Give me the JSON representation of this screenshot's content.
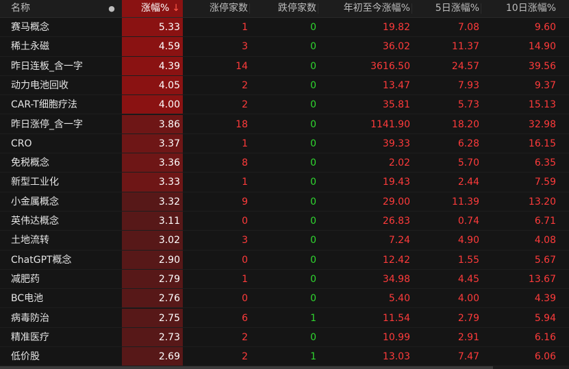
{
  "header": {
    "name": "名称",
    "dot": "●",
    "pct": "涨幅%",
    "sort_arrow": "↓",
    "up_count": "涨停家数",
    "down_count": "跌停家数",
    "ytd": "年初至今涨幅%",
    "d5": "5日涨幅%",
    "d10": "10日涨幅%"
  },
  "colors": {
    "up": "#ff3b3b",
    "down": "#2fd62f",
    "highlight_strong": "#8a1212",
    "highlight_mid": "#6e1616",
    "highlight_weak": "#571818"
  },
  "rows": [
    {
      "name": "赛马概念",
      "pct": "5.33",
      "up": "1",
      "down": "0",
      "ytd": "19.82",
      "d5": "7.08",
      "d10": "9.60"
    },
    {
      "name": "稀土永磁",
      "pct": "4.59",
      "up": "3",
      "down": "0",
      "ytd": "36.02",
      "d5": "11.37",
      "d10": "14.90"
    },
    {
      "name": "昨日连板_含一字",
      "pct": "4.39",
      "up": "14",
      "down": "0",
      "ytd": "3616.50",
      "d5": "24.57",
      "d10": "39.56"
    },
    {
      "name": "动力电池回收",
      "pct": "4.05",
      "up": "2",
      "down": "0",
      "ytd": "13.47",
      "d5": "7.93",
      "d10": "9.37"
    },
    {
      "name": "CAR-T细胞疗法",
      "pct": "4.00",
      "up": "2",
      "down": "0",
      "ytd": "35.81",
      "d5": "5.73",
      "d10": "15.13"
    },
    {
      "name": "昨日涨停_含一字",
      "pct": "3.86",
      "up": "18",
      "down": "0",
      "ytd": "1141.90",
      "d5": "18.20",
      "d10": "32.98"
    },
    {
      "name": "CRO",
      "pct": "3.37",
      "up": "1",
      "down": "0",
      "ytd": "39.33",
      "d5": "6.28",
      "d10": "16.15"
    },
    {
      "name": "免税概念",
      "pct": "3.36",
      "up": "8",
      "down": "0",
      "ytd": "2.02",
      "d5": "5.70",
      "d10": "6.35"
    },
    {
      "name": "新型工业化",
      "pct": "3.33",
      "up": "1",
      "down": "0",
      "ytd": "19.43",
      "d5": "2.44",
      "d10": "7.59"
    },
    {
      "name": "小金属概念",
      "pct": "3.32",
      "up": "9",
      "down": "0",
      "ytd": "29.00",
      "d5": "11.39",
      "d10": "13.20"
    },
    {
      "name": "英伟达概念",
      "pct": "3.11",
      "up": "0",
      "down": "0",
      "ytd": "26.83",
      "d5": "0.74",
      "d10": "6.71"
    },
    {
      "name": "土地流转",
      "pct": "3.02",
      "up": "3",
      "down": "0",
      "ytd": "7.24",
      "d5": "4.90",
      "d10": "4.08"
    },
    {
      "name": "ChatGPT概念",
      "pct": "2.90",
      "up": "0",
      "down": "0",
      "ytd": "12.42",
      "d5": "1.55",
      "d10": "5.67"
    },
    {
      "name": "减肥药",
      "pct": "2.79",
      "up": "1",
      "down": "0",
      "ytd": "34.98",
      "d5": "4.45",
      "d10": "13.67"
    },
    {
      "name": "BC电池",
      "pct": "2.76",
      "up": "0",
      "down": "0",
      "ytd": "5.40",
      "d5": "4.00",
      "d10": "4.39"
    },
    {
      "name": "病毒防治",
      "pct": "2.75",
      "up": "6",
      "down": "1",
      "ytd": "11.54",
      "d5": "2.79",
      "d10": "5.94"
    },
    {
      "name": "精准医疗",
      "pct": "2.73",
      "up": "2",
      "down": "0",
      "ytd": "10.99",
      "d5": "2.91",
      "d10": "6.16"
    },
    {
      "name": "低价股",
      "pct": "2.69",
      "up": "2",
      "down": "1",
      "ytd": "13.03",
      "d5": "7.47",
      "d10": "6.06"
    }
  ]
}
